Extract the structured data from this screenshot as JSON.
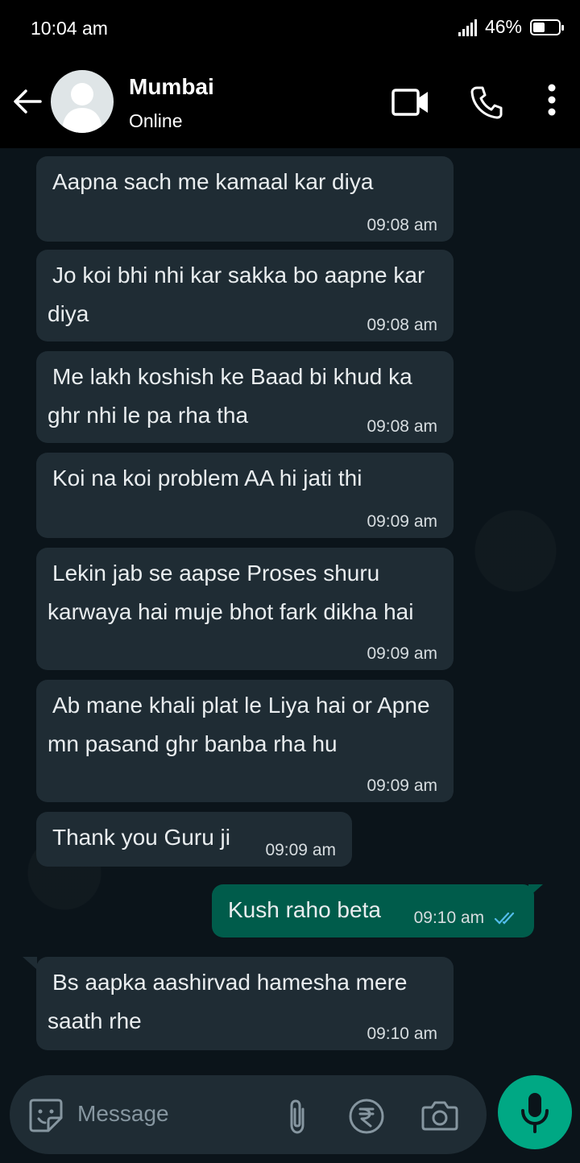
{
  "status_bar": {
    "time": "10:04 am",
    "battery": "46%",
    "battery_level": 0.46
  },
  "header": {
    "contact_name": "Mumbai",
    "contact_status": "Online"
  },
  "messages": [
    {
      "text": "Aapna sach me kamaal kar diya",
      "time": "09:08 am",
      "direction": "in"
    },
    {
      "text": "Jo koi bhi nhi kar sakka bo aapne kar diya",
      "time": "09:08 am",
      "direction": "in"
    },
    {
      "text": "Me lakh koshish ke Baad bi khud ka ghr nhi le pa rha tha",
      "time": "09:08 am",
      "direction": "in"
    },
    {
      "text": "Koi na koi problem AA hi jati thi",
      "time": "09:09 am",
      "direction": "in"
    },
    {
      "text": "Lekin jab se aapse Proses shuru karwaya hai muje bhot fark dikha hai",
      "time": "09:09 am",
      "direction": "in"
    },
    {
      "text": "Ab mane khali plat le Liya hai or Apne mn pasand ghr banba rha hu",
      "time": "09:09 am",
      "direction": "in"
    },
    {
      "text": "Thank you Guru ji",
      "time": "09:09 am",
      "direction": "in"
    },
    {
      "text": "Kush raho beta",
      "time": "09:10 am",
      "direction": "out",
      "status": "read"
    },
    {
      "text": "Bs aapka aashirvad hamesha mere saath rhe",
      "time": "09:10 am",
      "direction": "in"
    }
  ],
  "composer": {
    "placeholder": "Message"
  },
  "colors": {
    "incoming": "#1f2c34",
    "outgoing": "#005c4b",
    "accent": "#00a884",
    "read_ticks": "#53bdeb"
  },
  "icons": [
    "back-arrow-icon",
    "video-call-icon",
    "phone-icon",
    "more-options-icon",
    "sticker-icon",
    "attach-icon",
    "rupee-payment-icon",
    "camera-icon",
    "mic-icon"
  ]
}
